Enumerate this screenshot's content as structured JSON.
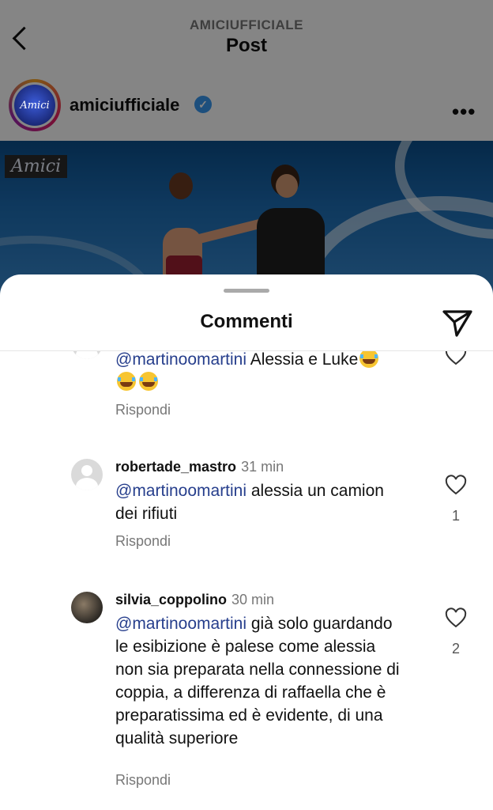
{
  "header": {
    "account_upper": "AMICIUFFICIALE",
    "title": "Post"
  },
  "post": {
    "account_name": "amiciufficiale",
    "avatar_text": "Amici",
    "photo_logo": "Amici",
    "verified": true
  },
  "sheet": {
    "title": "Commenti"
  },
  "comments": [
    {
      "mention": "@martinoomartini",
      "text": " Alessia e Luke",
      "emoji_count": 3,
      "reply_label": "Rispondi"
    },
    {
      "username": "robertade_mastro",
      "time": "31 min",
      "mention": "@martinoomartini",
      "text": " alessia un camion dei rifiuti",
      "likes": "1",
      "reply_label": "Rispondi"
    },
    {
      "username": "silvia_coppolino",
      "time": "30 min",
      "mention": "@martinoomartini",
      "text": " già solo guardando le esibizione è palese come alessia non sia preparata nella connessione di coppia, a differenza di raffaella che è preparatissima ed è evidente, di una qualità superiore",
      "likes": "2",
      "reply_label": "Rispondi"
    }
  ],
  "colors": {
    "mention": "#263e8c",
    "verified": "#3897f0"
  }
}
